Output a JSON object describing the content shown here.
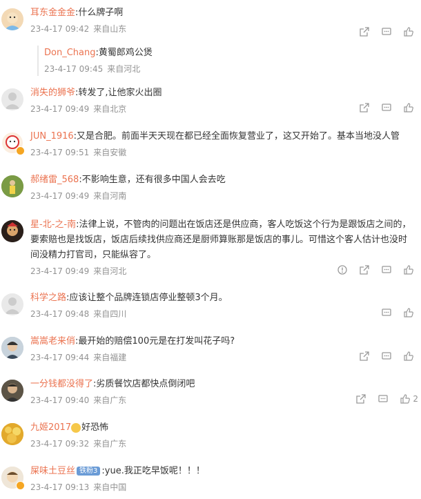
{
  "comments": [
    {
      "user": "耳东金金金",
      "text": ":什么牌子啊",
      "time": "23-4-17 09:42",
      "loc": "来自山东",
      "reply": {
        "user": "Don_Chang",
        "text": ":黄蜀郎鸡公煲",
        "time": "23-4-17 09:45",
        "loc": "来自河北"
      }
    },
    {
      "user": "消失的狮爷",
      "text": ":转发了,让他家火出圈",
      "time": "23-4-17 09:49",
      "loc": "来自北京"
    },
    {
      "user": "JUN_1916",
      "text": ":又是合肥。前面半天天现在都已经全面恢复营业了，这又开始了。基本当地没人管",
      "time": "23-4-17 09:51",
      "loc": "来自安徽"
    },
    {
      "user": "郝绪雷_568",
      "text": ":不影响生意，还有很多中国人会去吃",
      "time": "23-4-17 09:49",
      "loc": "来自河南"
    },
    {
      "user": "星-北-之-南",
      "text": ":法律上说，不管肉的问题出在饭店还是供应商，客人吃饭这个行为是跟饭店之间的，要索赔也是找饭店，饭店后续找供应商还是厨师算账那是饭店的事儿。可惜这个客人估计也没时间没精力打官司，只能纵容了。",
      "time": "23-4-17 09:49",
      "loc": "来自河北"
    },
    {
      "user": "科学之路",
      "text": ":应该让整个品牌连锁店停业整顿3个月。",
      "time": "23-4-17 09:48",
      "loc": "来自四川"
    },
    {
      "user": "嵩嵩老来俏",
      "text": ":最开始的赔偿100元是在打发叫花子吗?",
      "time": "23-4-17 09:44",
      "loc": "来自福建"
    },
    {
      "user": "一分钱都没得了",
      "text": ":劣质餐饮店都快点倒闭吧",
      "time": "23-4-17 09:40",
      "loc": "来自广东",
      "likes": "2"
    },
    {
      "user": "九姬2017",
      "text": "好恐怖",
      "time": "23-4-17 09:32",
      "loc": "来自广东"
    },
    {
      "user": "屎味土豆丝",
      "badge": "铁粉3",
      "text": ":yue.我正吃早饭呢！！！",
      "time": "23-4-17 09:13",
      "loc": "来自中国"
    }
  ],
  "colors": {
    "username": "#eb7350",
    "meta": "#939393"
  }
}
